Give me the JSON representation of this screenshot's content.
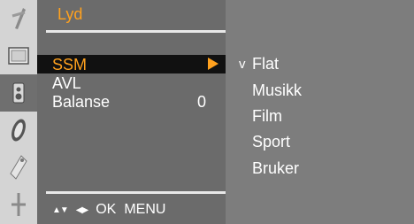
{
  "menu": {
    "title": "Lyd",
    "items": [
      {
        "label": "SSM",
        "value": ""
      },
      {
        "label": "AVL",
        "value": ""
      },
      {
        "label": "Balanse",
        "value": "0"
      }
    ]
  },
  "help": {
    "ok_label": "OK",
    "menu_label": "MENU"
  },
  "submenu": {
    "check_mark": "v",
    "options": [
      "Flat",
      "Musikk",
      "Film",
      "Sport",
      "Bruker"
    ],
    "selected": "Flat"
  },
  "icons": [
    "picture-icon",
    "screen-icon",
    "sound-icon",
    "time-icon",
    "special-icon",
    "setup-icon"
  ],
  "colors": {
    "accent": "#ffa11e",
    "selected_row": "#111111",
    "panel": "#6b6b6b",
    "iconbar": "#d4d4d4"
  }
}
